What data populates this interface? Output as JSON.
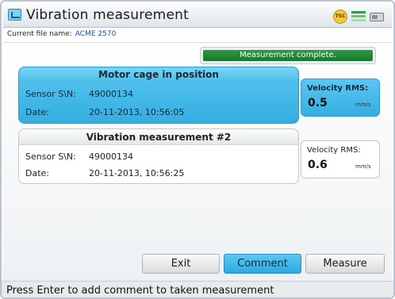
{
  "window": {
    "title": "Vibration measurement"
  },
  "status_icons": {
    "badge_text": "TSC",
    "signal": "signal-icon",
    "battery": "battery-icon"
  },
  "file": {
    "label": "Current file name:",
    "name": "ACME 2570"
  },
  "message": "Measurement complete.",
  "measurements": [
    {
      "title": "Motor cage in position",
      "sensor_label": "Sensor S\\N:",
      "sensor_value": "49000134",
      "date_label": "Date:",
      "date_value": "20-11-2013, 10:56:05",
      "velocity_label": "Velocity RMS:",
      "velocity_value": "0.5",
      "velocity_unit": "mm/s",
      "selected": true
    },
    {
      "title": "Vibration measurement #2",
      "sensor_label": "Sensor S\\N:",
      "sensor_value": "49000134",
      "date_label": "Date:",
      "date_value": "20-11-2013, 10:56:25",
      "velocity_label": "Velocity RMS:",
      "velocity_value": "0.6",
      "velocity_unit": "mm/s",
      "selected": false
    }
  ],
  "buttons": {
    "exit": "Exit",
    "comment": "Comment",
    "measure": "Measure"
  },
  "statusbar": {
    "text": "Press Enter to add comment to taken measurement"
  },
  "colors": {
    "accent": "#3bb4e6",
    "success": "#1f8a37"
  }
}
